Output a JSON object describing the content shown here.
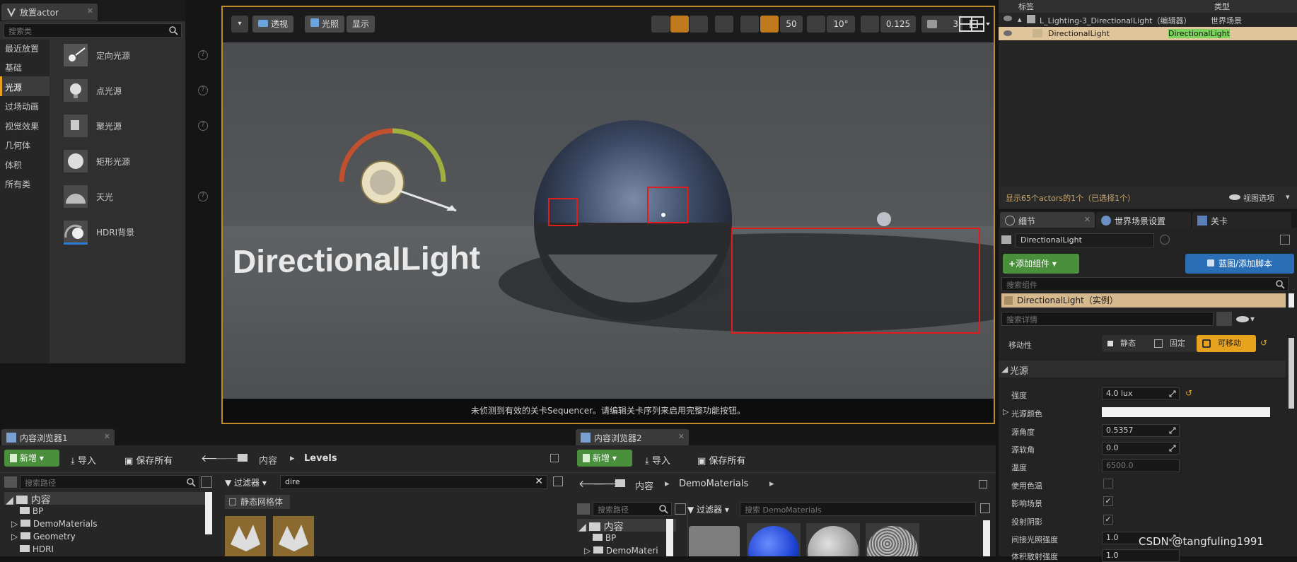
{
  "place_actor": {
    "tab": "放置actor",
    "search_placeholder": "搜索类",
    "categories": [
      "最近放置",
      "基础",
      "光源",
      "过场动画",
      "视觉效果",
      "几何体",
      "体积",
      "所有类"
    ],
    "items": [
      "定向光源",
      "点光源",
      "聚光源",
      "矩形光源",
      "天光",
      "HDRI背景"
    ]
  },
  "viewport": {
    "perspective": "透视",
    "lit": "光照",
    "show": "显示",
    "grid_snap": "50",
    "rot_snap": "10°",
    "scale_snap": "0.125",
    "cam_speed": "3",
    "overlay_text": "DirectionalLight",
    "status": "未侦测到有效的关卡Sequencer。请编辑关卡序列来启用完整功能按钮。"
  },
  "outliner": {
    "col_label": "标签",
    "col_type": "类型",
    "row1_name": "L_Lighting-3_DirectionalLight（编辑器）",
    "row1_type": "世界场景",
    "row2_name": "DirectionalLight",
    "row2_type": "DirectionalLight",
    "footer": "显示65个actors的1个（已选择1个）",
    "view_options": "视图选项"
  },
  "details": {
    "tab_details": "细节",
    "tab_world": "世界场景设置",
    "tab_level": "关卡",
    "actor_name": "DirectionalLight",
    "add_component": "添加组件",
    "blueprint": "蓝图/添加脚本",
    "search_components": "搜索组件",
    "instance": "DirectionalLight（实例）",
    "search_details": "搜索详情",
    "mobility_label": "移动性",
    "mob_static": "静态",
    "mob_stationary": "固定",
    "mob_movable": "可移动",
    "section_light": "光源",
    "props": [
      {
        "k": "强度",
        "v": "4.0 lux"
      },
      {
        "k": "光源颜色",
        "v": ""
      },
      {
        "k": "源角度",
        "v": "0.5357"
      },
      {
        "k": "源软角",
        "v": "0.0"
      },
      {
        "k": "温度",
        "v": "6500.0"
      },
      {
        "k": "使用色温",
        "v": ""
      },
      {
        "k": "影响场景",
        "v": ""
      },
      {
        "k": "投射阴影",
        "v": ""
      },
      {
        "k": "间接光照强度",
        "v": "1.0"
      },
      {
        "k": "体积散射强度",
        "v": "1.0"
      }
    ]
  },
  "cb1": {
    "tab": "内容浏览器1",
    "new": "新增",
    "import": "导入",
    "save_all": "保存所有",
    "path_root": "内容",
    "path_sub": "Levels",
    "search_path": "搜索路径",
    "filters": "过滤器",
    "search_value": "dire",
    "filter_tag": "静态网格体",
    "tree": [
      "内容",
      "BP",
      "DemoMaterials",
      "Geometry",
      "HDRI"
    ]
  },
  "cb2": {
    "tab": "内容浏览器2",
    "new": "新增",
    "import": "导入",
    "save_all": "保存所有",
    "path_root": "内容",
    "path_sub": "DemoMaterials",
    "search_path": "搜索路径",
    "filters": "过滤器",
    "search_placeholder": "搜索 DemoMaterials",
    "tree": [
      "内容",
      "BP",
      "DemoMateri"
    ]
  },
  "watermark": "CSDN @tangfuling1991"
}
